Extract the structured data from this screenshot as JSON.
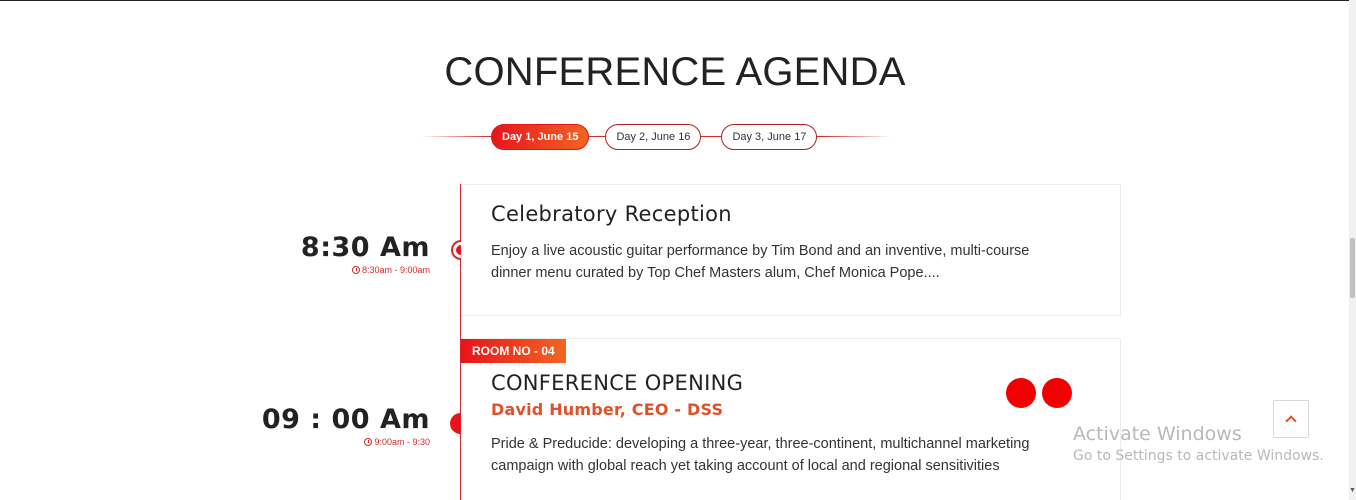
{
  "title": "CONFERENCE AGENDA",
  "tabs": [
    {
      "label": "Day 1, June 15",
      "active": true
    },
    {
      "label": "Day 2, June 16",
      "active": false
    },
    {
      "label": "Day 3, June 17",
      "active": false
    }
  ],
  "sessions": [
    {
      "time": "8:30 Am",
      "range": "8:30am - 9:00am",
      "title": "Celebratory Reception",
      "description": "Enjoy a live acoustic guitar performance by Tim Bond and an inventive, multi-course dinner menu curated by Top Chef Masters alum, Chef Monica Pope...."
    },
    {
      "time": "09 : 00 Am",
      "range": "9:00am - 9:30",
      "room": "ROOM NO - 04",
      "title": "CONFERENCE OPENING",
      "speaker": "David Humber, CEO - DSS",
      "description": "Pride & Preducide: developing a three-year, three-continent, multichannel marketing campaign with global reach yet taking account of local and regional sensitivities"
    }
  ],
  "watermark": {
    "title": "Activate Windows",
    "subtitle": "Go to Settings to activate Windows."
  },
  "colors": {
    "accent": "#e8141b",
    "accent_orange": "#f26522",
    "speaker": "#e0502a"
  },
  "icons": {
    "clock": "clock-icon",
    "scroll_top": "chevron-up-icon"
  }
}
